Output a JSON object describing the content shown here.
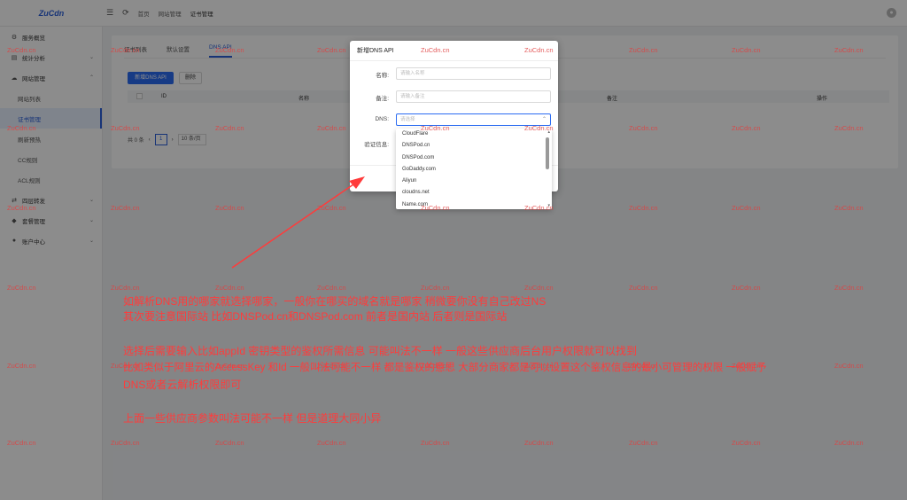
{
  "header": {
    "logo": "ZuCdn",
    "menu_icon": "☰",
    "refresh_icon": "⟳",
    "breadcrumb": [
      "首页",
      "网站管理",
      "证书管理"
    ]
  },
  "sidebar": {
    "items": [
      {
        "label": "服务概览",
        "icon": "⚙"
      },
      {
        "label": "统计分析",
        "icon": "▤",
        "arrow": "⌄"
      },
      {
        "label": "网站管理",
        "icon": "☁",
        "arrow": "⌃"
      },
      {
        "label": "网站列表",
        "sub": true
      },
      {
        "label": "证书管理",
        "sub": true,
        "active": true
      },
      {
        "label": "刷新预热",
        "sub": true
      },
      {
        "label": "CC规则",
        "sub": true
      },
      {
        "label": "ACL规则",
        "sub": true
      },
      {
        "label": "四层转发",
        "icon": "⇄",
        "arrow": "⌄"
      },
      {
        "label": "套餐管理",
        "icon": "◆",
        "arrow": "⌄"
      },
      {
        "label": "账户中心",
        "icon": "●",
        "arrow": "⌄"
      }
    ]
  },
  "main": {
    "tabs": [
      "证书列表",
      "默认设置",
      "DNS API"
    ],
    "add_button": "新增DNS API",
    "delete_button": "删除",
    "columns": [
      "ID",
      "名称",
      "备注",
      "操作"
    ],
    "pagination": {
      "total": "共 0 条",
      "prev": "‹",
      "page": "1",
      "next": "›",
      "page_size": "10 条/页"
    }
  },
  "modal": {
    "title": "新增DNS API",
    "name_label": "名称:",
    "name_placeholder": "请输入名称",
    "remark_label": "备注:",
    "remark_placeholder": "请输入备注",
    "dns_label": "DNS:",
    "dns_placeholder": "请选择",
    "dns_arrow": "⌃",
    "verify_label": "验证信息:"
  },
  "dropdown": {
    "options": [
      "CloudFlare",
      "DNSPod.cn",
      "DNSPod.com",
      "GoDaddy.com",
      "Aliyun",
      "cloudns.net",
      "Name.com"
    ]
  },
  "watermark": "ZuCdn.cn",
  "annotation": {
    "lines": [
      "如解析DNS用的哪家就选择哪家，一般你在哪买的域名就是哪家 稍微要你没有自己改过NS",
      "其次要注意国际站 比如DNSPod.cn和DNSPod.com 前者是国内站 后者则是国际站",
      "",
      "选择后需要输入比如appId 密钥类型的鉴权所需信息 可能叫法不一样 一般这些供应商后台用户权限就可以找到",
      "比如类似于阿里云的AccessKey 和Id 一般叫法可能不一样 都是鉴权的意思 大部分商家都是可以设置这个鉴权信息的最小可管理的权限 一般赋予",
      "DNS或者云解析权限即可",
      "",
      "上面一些供应商参数叫法可能不一样 但是道理大同小异"
    ]
  },
  "colors": {
    "accent": "#2b6cf2",
    "annotation": "#ff3b3b",
    "watermark": "#e04040"
  }
}
